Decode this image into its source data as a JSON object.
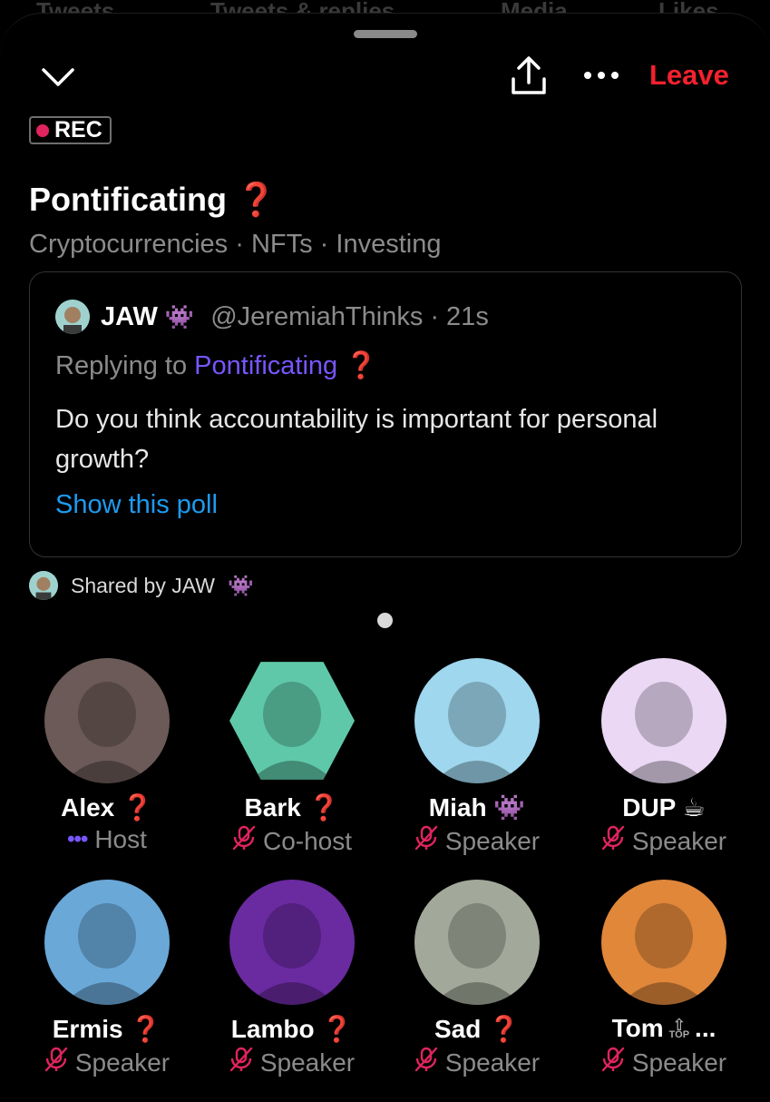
{
  "background_tabs": [
    "Tweets",
    "Tweets & replies",
    "Media",
    "Likes"
  ],
  "header": {
    "leave_label": "Leave"
  },
  "rec_badge": "REC",
  "space": {
    "title": "Pontificating",
    "title_emoji": "❓",
    "topics": "Cryptocurrencies · NFTs · Investing"
  },
  "pinned_tweet": {
    "author_name": "JAW",
    "author_emoji": "👾",
    "author_handle": "@JeremiahThinks",
    "time": "· 21s",
    "replying_prefix": "Replying to",
    "replying_to": "Pontificating",
    "replying_emoji": "❓",
    "body": "Do you think accountability is important for personal growth?",
    "action_label": "Show this poll"
  },
  "shared_by": "Shared by JAW",
  "shared_by_emoji": "👾",
  "participants": [
    {
      "name": "Alex",
      "emoji": "❓",
      "role": "Host",
      "color": "#6b5a57"
    },
    {
      "name": "Bark",
      "emoji": "❓",
      "role": "Co-host",
      "color": "#5fc8a8"
    },
    {
      "name": "Miah",
      "emoji": "👾",
      "role": "Speaker",
      "color": "#9fd7ee"
    },
    {
      "name": "DUP",
      "emoji": "☕",
      "role": "Speaker",
      "color": "#ead8f4"
    },
    {
      "name": "Ermis",
      "emoji": "❓",
      "role": "Speaker",
      "color": "#6aa8d8"
    },
    {
      "name": "Lambo",
      "emoji": "❓",
      "role": "Speaker",
      "color": "#6a2aa0"
    },
    {
      "name": "Sad",
      "emoji": "❓",
      "role": "Speaker",
      "color": "#a3a99a"
    },
    {
      "name": "Tom",
      "emoji": "...",
      "top_badge": "TOP",
      "role": "Speaker",
      "color": "#e0873a"
    }
  ],
  "colors": {
    "accent_red": "#f4212e",
    "accent_purple": "#7856ff",
    "link_blue": "#1d9bf0",
    "muted_pink": "#e0245e"
  }
}
